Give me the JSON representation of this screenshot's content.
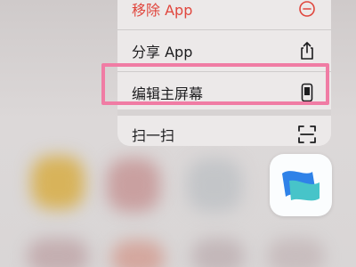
{
  "menu": {
    "remove_label": "移除 App",
    "share_label": "分享 App",
    "edit_label": "编辑主屏幕",
    "scan_label": "扫一扫"
  },
  "colors": {
    "destructive": "#e0463d",
    "highlight": "#f07ca4",
    "app_blue": "#2f82e8",
    "app_teal": "#47c4c9"
  },
  "icons": {
    "remove": "minus-circle-icon",
    "share": "share-icon",
    "edit": "phone-icon",
    "scan": "scan-frame-icon",
    "app": "app-logo-icon"
  }
}
